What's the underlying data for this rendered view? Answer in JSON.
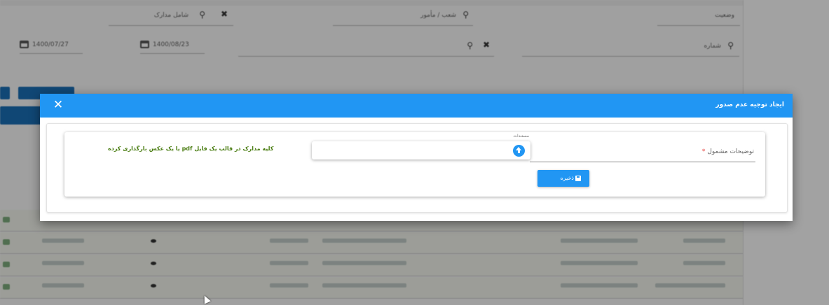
{
  "background": {
    "filters": [
      {
        "label": "شامل مدارک",
        "cleared": true
      },
      {
        "label": "شعب / مأمور",
        "cleared": false
      },
      {
        "label": "وضعیت",
        "cleared": false
      }
    ],
    "date_from": "1400/07/27",
    "date_to": "1400/08/23",
    "search_field_label": "شماره"
  },
  "modal": {
    "title": "ایجاد توجیه عدم صدور",
    "close_icon": "close-icon",
    "form": {
      "description_label": "توضیحات مشمول",
      "required_mark": "*",
      "description_value": "",
      "file_caption": "مستندات",
      "upload_icon": "upload-icon",
      "upload_note": "کلیه مدارک در قالب یک فایل pdf یا یک عکس بارگذاری کرده",
      "save_label": "ذخیره",
      "save_icon": "save-icon"
    }
  },
  "colors": {
    "header": "#2196f3",
    "note_text": "#4a7d12",
    "required": "#e53935"
  }
}
